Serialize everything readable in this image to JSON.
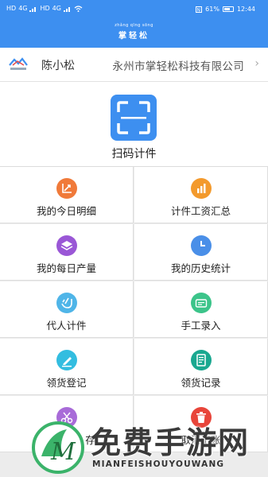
{
  "status_bar": {
    "left_labels": [
      "HD",
      "4G",
      "HD",
      "4G"
    ],
    "battery": "61%",
    "time": "12:44"
  },
  "header": {
    "pinyin": "zhǎng qīng sōng",
    "title": "掌轻松"
  },
  "user": {
    "name": "陈小松",
    "company": "永州市掌轻松科技有限公司",
    "chevron": "›"
  },
  "scan": {
    "label": "扫码计件",
    "icon": "scan-frame-icon"
  },
  "menu": [
    {
      "label": "我的今日明细",
      "icon": "chart-axis-icon",
      "color": "#f07a3a"
    },
    {
      "label": "计件工资汇总",
      "icon": "bar-chart-icon",
      "color": "#f39a2d"
    },
    {
      "label": "我的每日产量",
      "icon": "layers-icon",
      "color": "#9a57d6"
    },
    {
      "label": "我的历史统计",
      "icon": "clock-icon",
      "color": "#4a8fe8"
    },
    {
      "label": "代人计件",
      "icon": "hand-icon",
      "color": "#4fb5e8"
    },
    {
      "label": "手工录入",
      "icon": "card-icon",
      "color": "#3cc48a"
    },
    {
      "label": "领货登记",
      "icon": "edit-icon",
      "color": "#33bde0"
    },
    {
      "label": "领货记录",
      "icon": "document-icon",
      "color": "#1aa890"
    },
    {
      "label": "存",
      "icon": "scissors-icon",
      "color": "#a86bd8"
    },
    {
      "label": "取消记账",
      "icon": "trash-icon",
      "color": "#e8453a"
    }
  ],
  "watermark": {
    "text": "免费手游网",
    "subtext": "MIANFEISHOUYOUWANG",
    "logo_letter": "M"
  }
}
